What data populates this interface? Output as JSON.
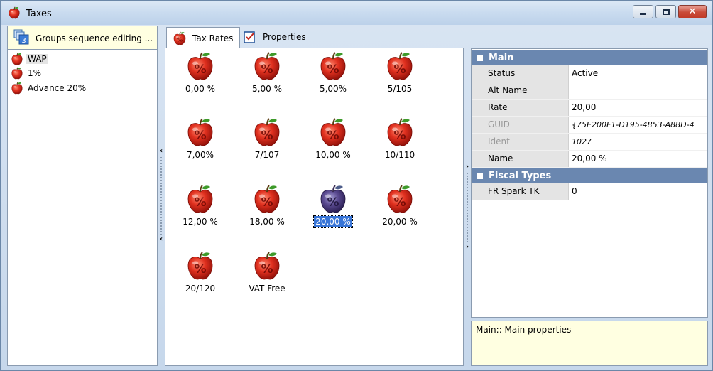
{
  "window": {
    "title": "Taxes"
  },
  "left": {
    "header": "Groups sequence editing ...",
    "groups_icon_number": "3",
    "items": [
      {
        "label": "WAP",
        "selected": true
      },
      {
        "label": "1%",
        "selected": false
      },
      {
        "label": "Advance 20%",
        "selected": false
      }
    ]
  },
  "tabs": [
    {
      "label": "Tax Rates",
      "active": true,
      "icon": "percent-apple-icon"
    },
    {
      "label": "Properties",
      "active": false,
      "icon": "properties-checklist-icon"
    }
  ],
  "rates": [
    {
      "label": "0,00 %",
      "selected": false
    },
    {
      "label": "5,00 %",
      "selected": false
    },
    {
      "label": "5,00%",
      "selected": false
    },
    {
      "label": "5/105",
      "selected": false
    },
    {
      "label": "7,00%",
      "selected": false
    },
    {
      "label": "7/107",
      "selected": false
    },
    {
      "label": "10,00 %",
      "selected": false
    },
    {
      "label": "10/110",
      "selected": false
    },
    {
      "label": "12,00 %",
      "selected": false
    },
    {
      "label": "18,00 %",
      "selected": false
    },
    {
      "label": "20,00 %",
      "selected": true
    },
    {
      "label": "20,00 %",
      "selected": false
    },
    {
      "label": "20/120",
      "selected": false
    },
    {
      "label": "VAT Free",
      "selected": false
    }
  ],
  "props": {
    "main_category": "Main",
    "main": [
      {
        "name": "Status",
        "value": "Active",
        "dim": false,
        "italic": false
      },
      {
        "name": "Alt Name",
        "value": "",
        "dim": false,
        "italic": false
      },
      {
        "name": "Rate",
        "value": "20,00",
        "dim": false,
        "italic": false
      },
      {
        "name": "GUID",
        "value": "{75E200F1-D195-4853-A88D-4",
        "dim": true,
        "italic": true
      },
      {
        "name": "Ident",
        "value": "1027",
        "dim": true,
        "italic": true
      },
      {
        "name": "Name",
        "value": "20,00 %",
        "dim": false,
        "italic": false
      }
    ],
    "fiscal_category": "Fiscal Types",
    "fiscal": [
      {
        "name": "FR Spark TK",
        "value": "0",
        "dim": false,
        "italic": false
      }
    ]
  },
  "help": {
    "text": "Main:: Main properties"
  },
  "colors": {
    "apple": "#d8261c",
    "apple_selected": "#5a4a90",
    "selection": "#3875d7",
    "category": "#6a87b0"
  }
}
